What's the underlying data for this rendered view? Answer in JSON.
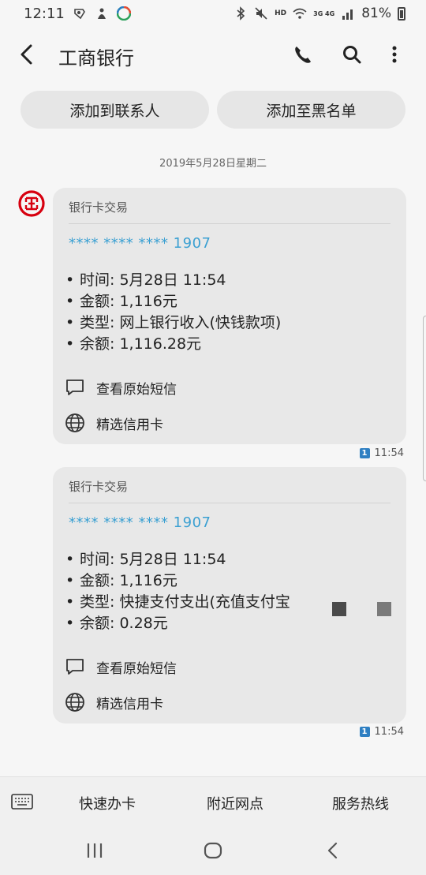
{
  "status_bar": {
    "time": "12:11",
    "battery": "81%",
    "hd": "HD",
    "network": "3G 4G"
  },
  "app_bar": {
    "title": "工商银行"
  },
  "actions": {
    "add_contact": "添加到联系人",
    "add_blacklist": "添加至黑名单"
  },
  "conversation": {
    "date": "2019年5月28日星期二",
    "messages": [
      {
        "header": "银行卡交易",
        "card": "**** **** **** 1907",
        "lines": [
          "时间: 5月28日 11:54",
          "金额: 1,116元",
          "类型: 网上银行收入(快钱款项)",
          "余额: 1,116.28元"
        ],
        "action_view": "查看原始短信",
        "action_card": "精选信用卡",
        "time": "11:54",
        "sim": "1"
      },
      {
        "header": "银行卡交易",
        "card": "**** **** **** 1907",
        "lines": [
          "时间: 5月28日 11:54",
          "金额: 1,116元",
          "类型: 快捷支付支出(充值支付宝",
          "余额: 0.28元"
        ],
        "action_view": "查看原始短信",
        "action_card": "精选信用卡",
        "time": "11:54",
        "sim": "1"
      }
    ]
  },
  "bottom_menu": {
    "item1": "快速办卡",
    "item2": "附近网点",
    "item3": "服务热线"
  },
  "bullet": "•",
  "colors": {
    "card_number": "#3ba0d2",
    "icbc_red": "#d7000f",
    "sim_badge": "#2e7fc2"
  }
}
